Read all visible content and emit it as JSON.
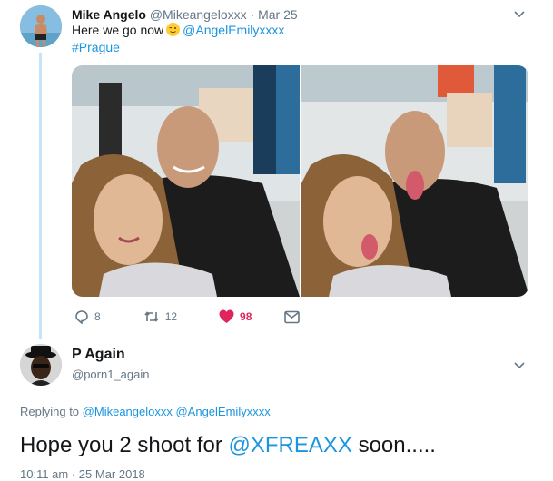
{
  "tweet1": {
    "author_name": "Mike Angelo",
    "handle": "@Mikeangeloxxx",
    "separator": "·",
    "date": "Mar 25",
    "text_prefix": "Here we go now",
    "emoji": "winking-face",
    "mention": "@AngelEmilyxxxx",
    "hashtag": "#Prague",
    "photos": [
      "selfie-smiling",
      "selfie-tongue-out"
    ],
    "actions": {
      "replies": "8",
      "retweets": "12",
      "likes": "98"
    }
  },
  "tweet2": {
    "author_name": "P Again",
    "handle": "@porn1_again",
    "replying_label": "Replying to",
    "replying_mention_1": "@Mikeangeloxxx",
    "replying_mention_2": "@AngelEmilyxxxx",
    "text_prefix": "Hope you 2 shoot for",
    "text_mention": "@XFREAXX",
    "text_suffix": "soon.....",
    "timestamp_partial": "10:11 am · 25 Mar 2018"
  },
  "colors": {
    "link": "#1b95e0",
    "secondary": "#657786",
    "like": "#e0245e",
    "thread": "#c4e4fa"
  }
}
